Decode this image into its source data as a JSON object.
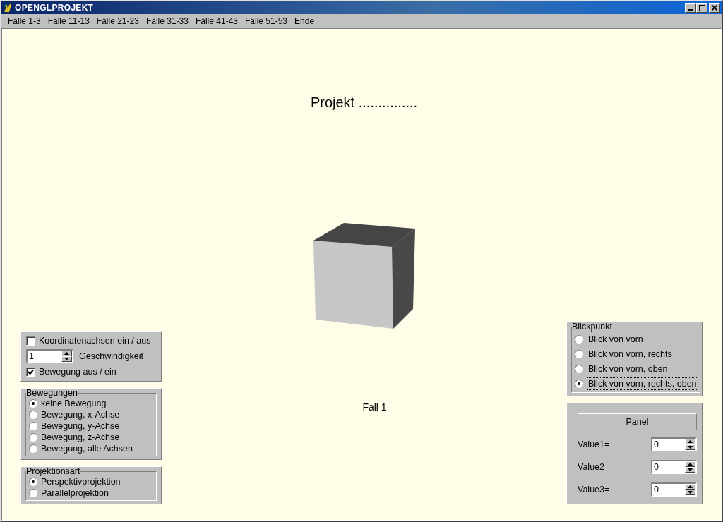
{
  "window": {
    "title": "OPENGLPROJEKT"
  },
  "menu": [
    {
      "label": "Fälle 1-3"
    },
    {
      "label": "Fälle 11-13"
    },
    {
      "label": "Fälle 21-23"
    },
    {
      "label": "Fälle 31-33"
    },
    {
      "label": "Fälle 41-43"
    },
    {
      "label": "Fälle 51-53"
    },
    {
      "label": "Ende"
    }
  ],
  "heading": "Projekt ...............",
  "caption": "Fall 1",
  "options": {
    "axes": {
      "label": "Koordinatenachsen ein / aus",
      "checked": false
    },
    "speed": {
      "value": "1",
      "label": "Geschwindigkeit"
    },
    "motion": {
      "label": "Bewegung aus / ein",
      "checked": true
    }
  },
  "movements": {
    "title": "Bewegungen",
    "items": [
      {
        "label": "keine Bewegung",
        "selected": true
      },
      {
        "label": "Bewegung, x-Achse",
        "selected": false
      },
      {
        "label": "Bewegung, y-Achse",
        "selected": false
      },
      {
        "label": "Bewegung, z-Achse",
        "selected": false
      },
      {
        "label": "Bewegung, alle Achsen",
        "selected": false
      }
    ]
  },
  "projection": {
    "title": "Projektionsart",
    "items": [
      {
        "label": "Perspektivprojektion",
        "selected": true
      },
      {
        "label": "Parallelprojektion",
        "selected": false
      }
    ]
  },
  "viewpoint": {
    "title": "Blickpunkt",
    "items": [
      {
        "label": "Blick von vorn",
        "selected": false,
        "focused": false
      },
      {
        "label": "Blick von vorn, rechts",
        "selected": false,
        "focused": false
      },
      {
        "label": "Blick von vorn, oben",
        "selected": false,
        "focused": false
      },
      {
        "label": "Blick von vorn, rechts, oben",
        "selected": true,
        "focused": true
      }
    ]
  },
  "panel": {
    "button": "Panel",
    "values": [
      {
        "label": "Value1=",
        "value": "0"
      },
      {
        "label": "Value2=",
        "value": "0"
      },
      {
        "label": "Value3=",
        "value": "0"
      }
    ]
  }
}
